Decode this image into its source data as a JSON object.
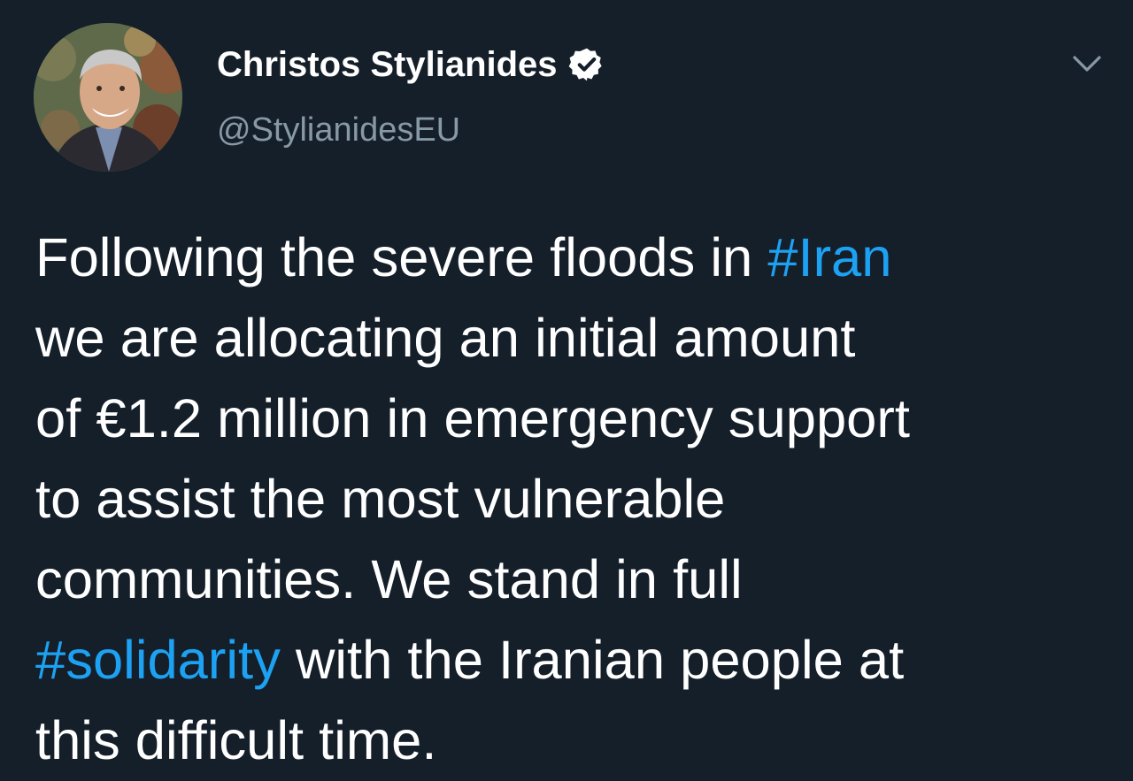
{
  "author": {
    "display_name": "Christos Stylianides",
    "handle": "@StylianidesEU",
    "verified": true,
    "avatar_icon": "profile-photo"
  },
  "menu": {
    "icon": "chevron-down-icon"
  },
  "tweet": {
    "lines": [
      {
        "pre": "Following the severe floods in ",
        "hashtag": "#Iran",
        "post": ""
      },
      {
        "pre": "we are allocating an initial amount",
        "hashtag": "",
        "post": ""
      },
      {
        "pre": "of €1.2 million in emergency support",
        "hashtag": "",
        "post": ""
      },
      {
        "pre": "to assist the most vulnerable",
        "hashtag": "",
        "post": ""
      },
      {
        "pre": "communities. We stand in full",
        "hashtag": "",
        "post": ""
      },
      {
        "pre": "",
        "hashtag": "#solidarity",
        "post": " with the Iranian people at"
      },
      {
        "pre": "this difficult time.",
        "hashtag": "",
        "post": ""
      }
    ]
  },
  "colors": {
    "background": "#151f2a",
    "text": "#ffffff",
    "secondary_text": "#8899a6",
    "link": "#1da1f2"
  }
}
